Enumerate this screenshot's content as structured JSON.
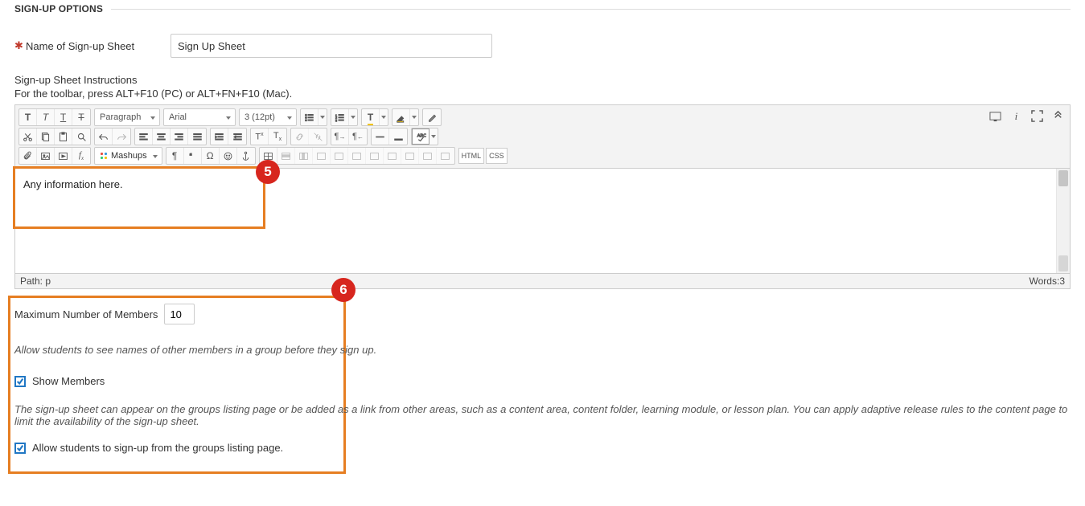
{
  "section": {
    "title": "SIGN-UP OPTIONS"
  },
  "name_field": {
    "label": "Name of Sign-up Sheet",
    "value": "Sign Up Sheet"
  },
  "instructions": {
    "label": "Sign-up Sheet Instructions",
    "hint": "For the toolbar, press ALT+F10 (PC) or ALT+FN+F10 (Mac).",
    "content": "Any information here."
  },
  "toolbar": {
    "paragraph": "Paragraph",
    "font": "Arial",
    "size": "3 (12pt)",
    "mashups": "Mashups",
    "html": "HTML",
    "css": "CSS"
  },
  "status": {
    "path_label": "Path:",
    "path_value": "p",
    "words_label": "Words:",
    "words_value": "3"
  },
  "markers": {
    "m5": "5",
    "m6": "6"
  },
  "members": {
    "max_label": "Maximum Number of Members",
    "max_value": "10",
    "desc1": "Allow students to see names of other members in a group before they sign up.",
    "show_members_label": "Show Members",
    "desc2": "The sign-up sheet can appear on the groups listing page or be added as a link from other areas, such as a content area, content folder, learning module, or lesson plan. You can apply adaptive release rules to the content page to limit the availability of the sign-up sheet.",
    "allow_signup_label": "Allow students to sign-up from the groups listing page."
  }
}
